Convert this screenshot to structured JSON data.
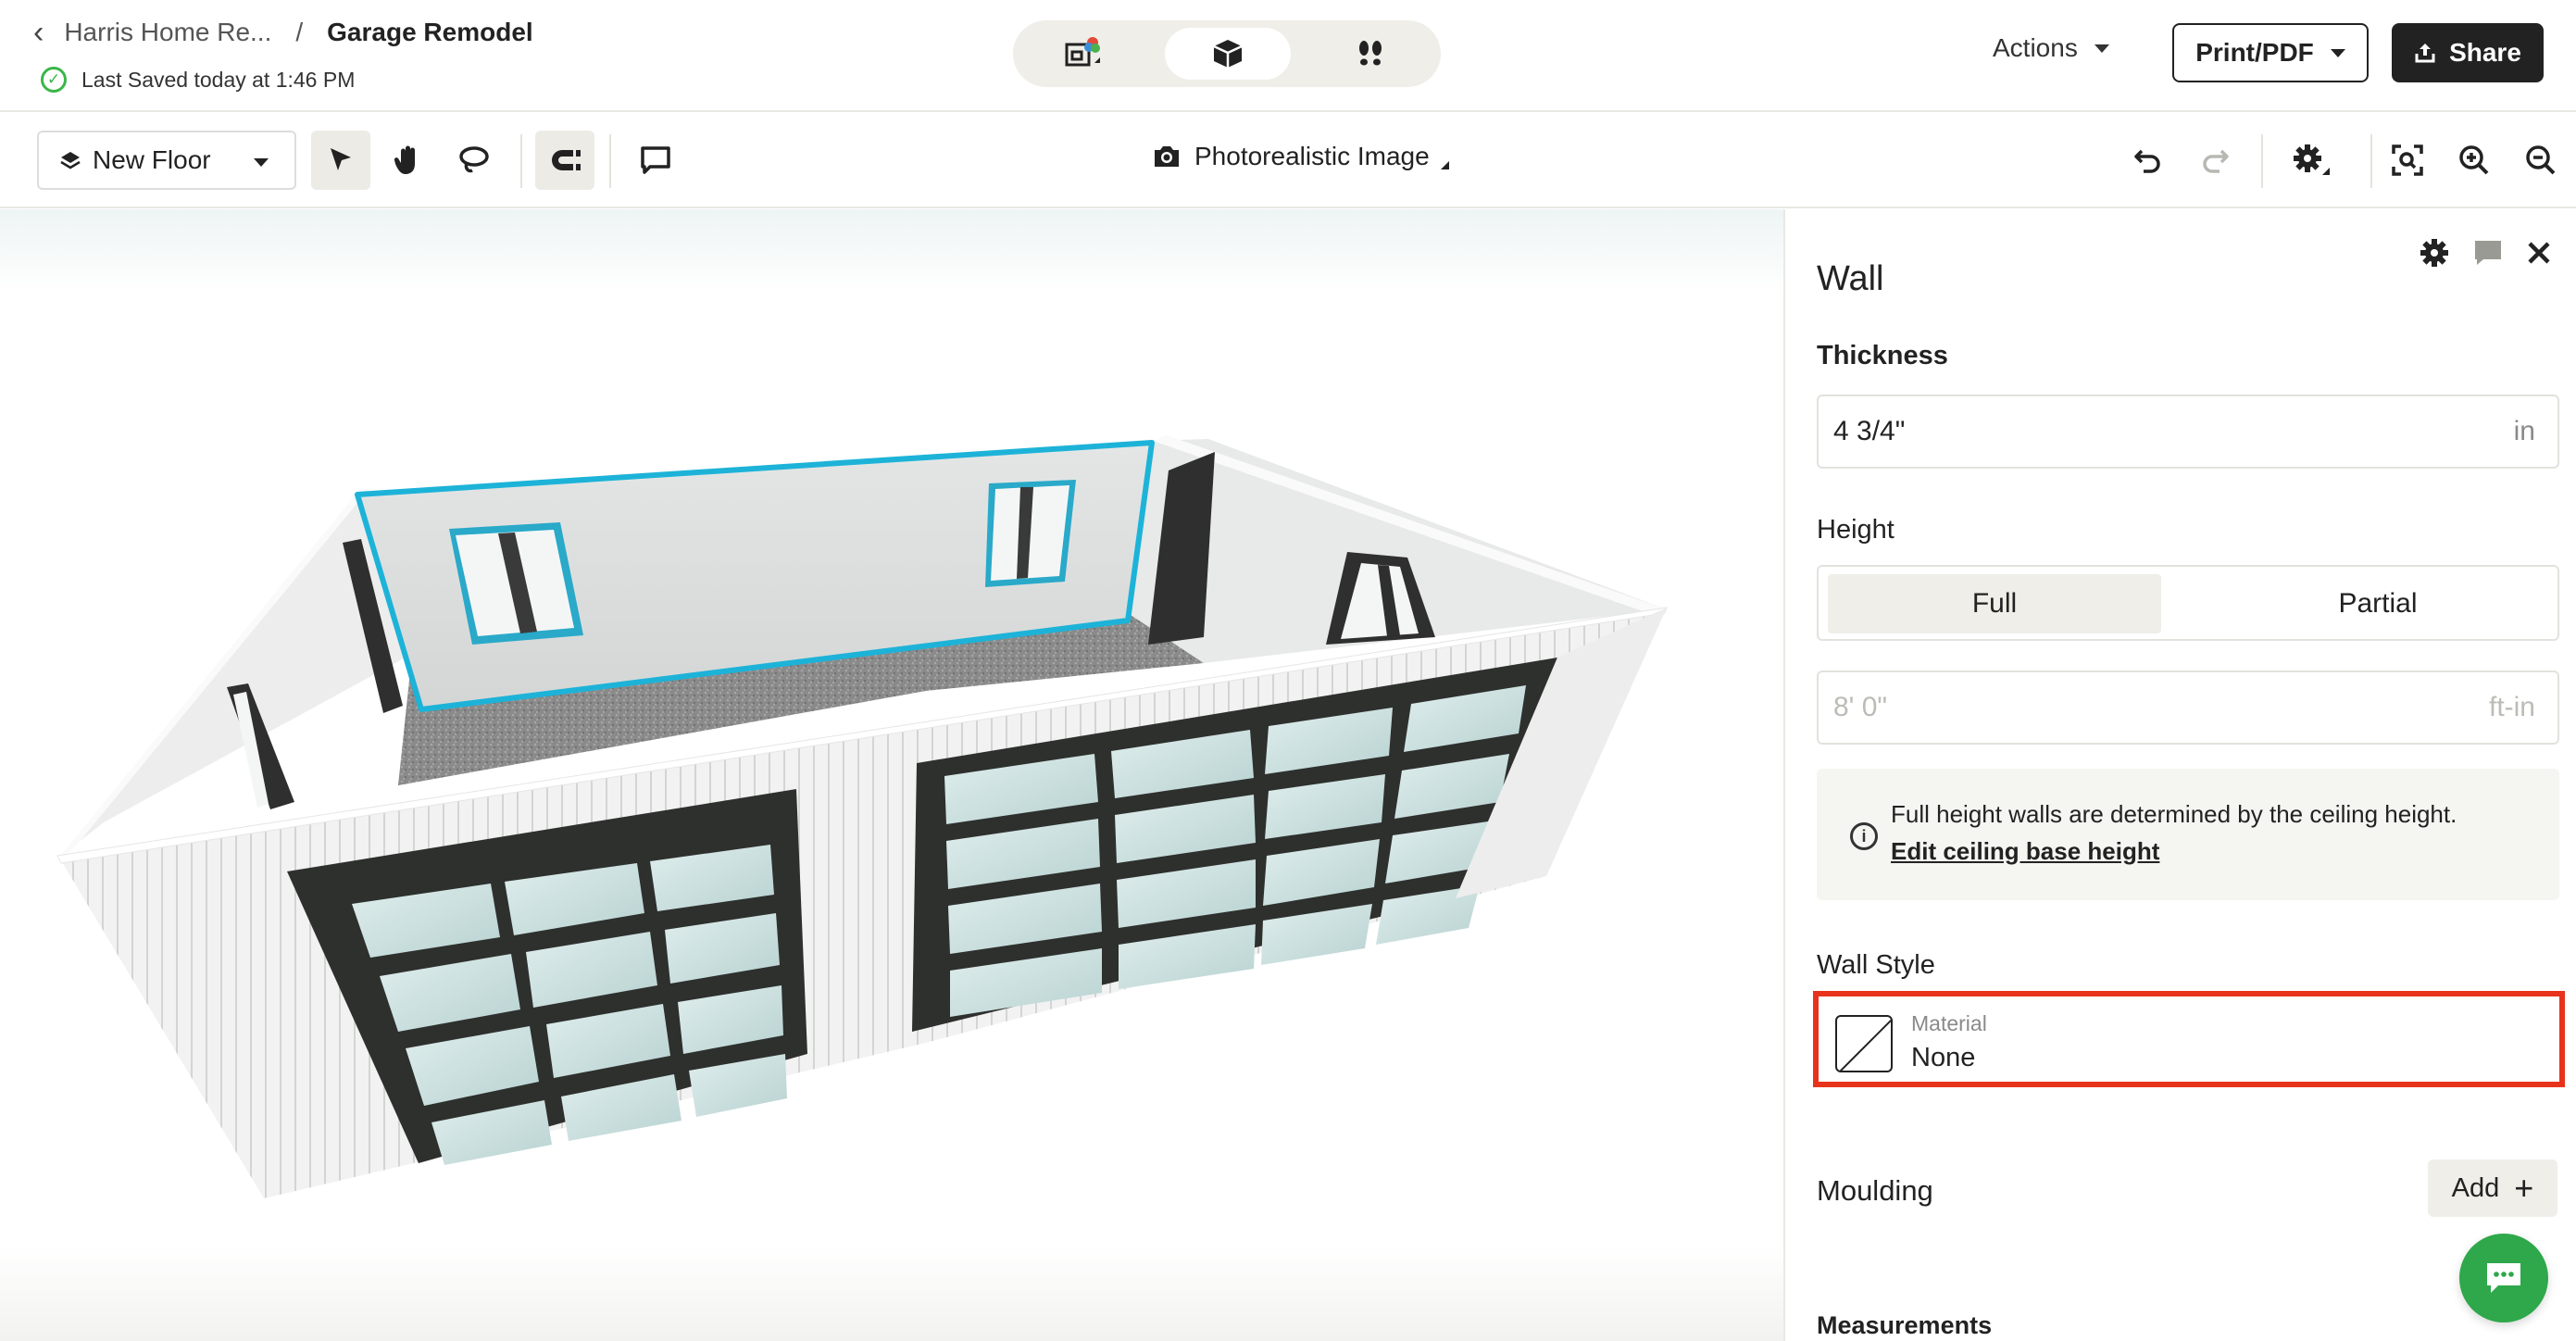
{
  "header": {
    "breadcrumb_project": "Harris Home Re...",
    "breadcrumb_separator": "/",
    "breadcrumb_page": "Garage Remodel",
    "saved_status": "Last Saved today at 1:46 PM",
    "view_modes": [
      "2d-plan-icon",
      "3d-cube-icon",
      "footsteps-icon"
    ],
    "active_view": "3d-cube-icon",
    "actions_label": "Actions",
    "print_label": "Print/PDF",
    "share_label": "Share"
  },
  "toolbar": {
    "floor_label": "New Floor",
    "tools": [
      "select-arrow-icon",
      "hand-pan-icon",
      "lasso-icon",
      "magnet-snap-icon",
      "comment-icon"
    ],
    "photo_label": "Photorealistic Image",
    "right_tools": [
      "undo-icon",
      "redo-icon",
      "settings-icon",
      "fit-view-icon",
      "zoom-in-icon",
      "zoom-out-icon"
    ]
  },
  "panel": {
    "title": "Wall",
    "thickness_label": "Thickness",
    "thickness_value": "4 3/4\"",
    "thickness_unit": "in",
    "height_label": "Height",
    "height_options": [
      "Full",
      "Partial"
    ],
    "height_selected": "Full",
    "height_value": "8' 0\"",
    "height_unit": "ft-in",
    "info_text": "Full height walls are determined by the ceiling height.",
    "info_link": "Edit ceiling base height",
    "wall_style_label": "Wall Style",
    "material_label": "Material",
    "material_value": "None",
    "moulding_label": "Moulding",
    "add_label": "Add",
    "measurements_label": "Measurements"
  },
  "colors": {
    "accent_highlight": "#e8331c",
    "selection": "#1db3d8",
    "saved_ok": "#3cb54a",
    "chat": "#2ea84a",
    "dark_button": "#222222"
  }
}
